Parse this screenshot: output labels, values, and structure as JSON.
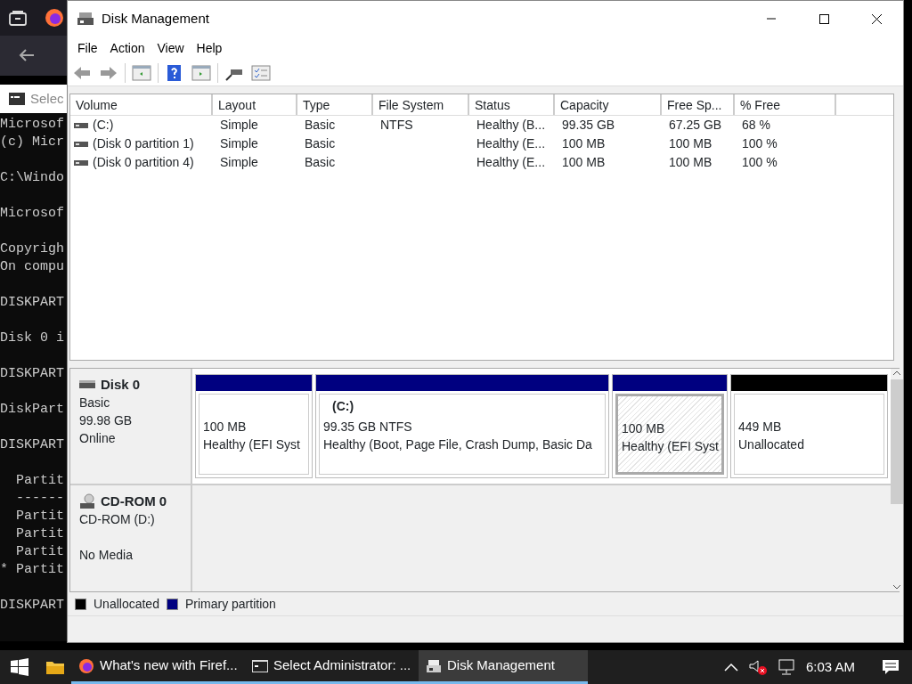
{
  "terminal": {
    "title": "Selec",
    "blocks": [
      [
        "Microsof",
        "(c) Micr"
      ],
      [
        "C:\\Windo"
      ],
      [
        "Microsof"
      ],
      [
        "Copyrigh",
        "On compu"
      ],
      [
        "DISKPART"
      ],
      [
        "Disk 0 i"
      ],
      [
        "DISKPART"
      ],
      [
        "DiskPart"
      ],
      [
        "DISKPART"
      ],
      [
        "  Partit",
        "  ------",
        "  Partit",
        "  Partit",
        "  Partit",
        "* Partit"
      ],
      [
        "DISKPART"
      ]
    ]
  },
  "window": {
    "title": "Disk Management"
  },
  "menu": [
    "File",
    "Action",
    "View",
    "Help"
  ],
  "volumes": {
    "columns": [
      "Volume",
      "Layout",
      "Type",
      "File System",
      "Status",
      "Capacity",
      "Free Sp...",
      "% Free"
    ],
    "rows": [
      [
        "(C:)",
        "Simple",
        "Basic",
        "NTFS",
        "Healthy (B...",
        "99.35 GB",
        "67.25 GB",
        "68 %"
      ],
      [
        "(Disk 0 partition 1)",
        "Simple",
        "Basic",
        "",
        "Healthy (E...",
        "100 MB",
        "100 MB",
        "100 %"
      ],
      [
        "(Disk 0 partition 4)",
        "Simple",
        "Basic",
        "",
        "Healthy (E...",
        "100 MB",
        "100 MB",
        "100 %"
      ]
    ]
  },
  "disks": [
    {
      "kind": "disk",
      "name": "Disk 0",
      "type": "Basic",
      "size": "99.98 GB",
      "status": "Online",
      "partitions": [
        {
          "kind": "primary",
          "selected": false,
          "size": "100 MB",
          "status": "Healthy (EFI Syst"
        },
        {
          "kind": "primary",
          "selected": false,
          "label": "(C:)",
          "size": "99.35 GB NTFS",
          "status": "Healthy (Boot, Page File, Crash Dump, Basic Da"
        },
        {
          "kind": "primary",
          "selected": true,
          "size": "100 MB",
          "status": "Healthy (EFI Syst"
        },
        {
          "kind": "unallocated",
          "selected": false,
          "size": "449 MB",
          "status": "Unallocated"
        }
      ]
    },
    {
      "kind": "cdrom",
      "name": "CD-ROM 0",
      "type": "CD-ROM (D:)",
      "status": "No Media"
    }
  ],
  "legend": [
    {
      "label": "Unallocated",
      "color": "#000000"
    },
    {
      "label": "Primary partition",
      "color": "#000080"
    }
  ],
  "taskbar": {
    "apps": [
      {
        "kind": "firefox",
        "label": "What's new with Firef...",
        "selected": false
      },
      {
        "kind": "cmd",
        "label": "Select Administrator: ...",
        "selected": false
      },
      {
        "kind": "disk",
        "label": "Disk Management",
        "selected": true
      }
    ],
    "clock": "6:03 AM"
  }
}
